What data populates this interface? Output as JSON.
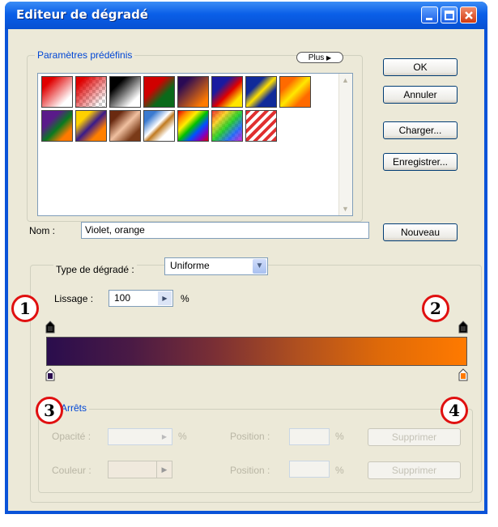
{
  "window": {
    "title": "Editeur de dégradé"
  },
  "presets": {
    "legend": "Paramètres prédéfinis",
    "more_label": "Plus",
    "swatches": [
      {
        "name": "red-white",
        "css": "linear-gradient(135deg,#e00000 20%,#ffffff 80%)"
      },
      {
        "name": "red-transparent",
        "css": "linear-gradient(135deg,#e00000 15%,rgba(255,255,255,0) 85%),repeating-conic-gradient(#ccc 0 25%,#fff 0 50%) 0 0/8px 8px"
      },
      {
        "name": "black-white",
        "css": "linear-gradient(135deg,#000 25%,#ffffff 80%)"
      },
      {
        "name": "red-green",
        "css": "linear-gradient(135deg,#d00000 35%,#0a6a1a 65%)"
      },
      {
        "name": "violet-orange",
        "css": "linear-gradient(135deg,#2a0a55 20%,#ff7a00 85%)"
      },
      {
        "name": "blue-red-yellow",
        "css": "linear-gradient(135deg,#1a1aa0 30%,#e00000 55%,#ffe600 80%)"
      },
      {
        "name": "blue-yellow-blue",
        "css": "linear-gradient(135deg,#102a9a 30%,#ffe000 50%,#102a9a 70%)"
      },
      {
        "name": "orange-yellow-orange",
        "css": "linear-gradient(135deg,#ff6a00 25%,#ffe800 50%,#ff6a00 75%)"
      },
      {
        "name": "violet-green-orange",
        "css": "linear-gradient(135deg,#5a1a8a 30%,#0a7a20 55%,#ff7a00 80%)"
      },
      {
        "name": "yellow-violet-orange",
        "css": "linear-gradient(135deg,#ffd000 25%,#3a1a8a 50%,#ff8000 75%)"
      },
      {
        "name": "copper",
        "css": "linear-gradient(135deg,#6a2a10 20%,#f0c0a0 50%,#7a3a18 80%)"
      },
      {
        "name": "chrome",
        "css": "linear-gradient(135deg,#3a7ad0 20%,#ffffff 45%,#c07a20 55%,#ffffff 75%)"
      },
      {
        "name": "spectrum",
        "css": "linear-gradient(135deg,#e00000,#ff8800,#ffee00,#00c000,#0050ff,#8000c0,#e00000)"
      },
      {
        "name": "transparent-rainbow",
        "css": "linear-gradient(135deg,rgba(230,0,0,0.8),rgba(255,200,0,0.8),rgba(0,200,0,0.8),rgba(0,80,255,0.8),rgba(200,0,200,0.8)),repeating-conic-gradient(#ccc 0 25%,#fff 0 50%) 0 0/8px 8px"
      },
      {
        "name": "transparent-stripes",
        "css": "repeating-linear-gradient(135deg,#e03030 0 4px,#ffffff 4px 8px)"
      }
    ]
  },
  "buttons": {
    "ok": "OK",
    "cancel": "Annuler",
    "load": "Charger...",
    "save": "Enregistrer...",
    "new": "Nouveau"
  },
  "name_field": {
    "label": "Nom :",
    "value": "Violet, orange"
  },
  "gradient_type": {
    "label": "Type de dégradé :",
    "value": "Uniforme"
  },
  "smoothness": {
    "label": "Lissage :",
    "value": "100",
    "unit": "%"
  },
  "gradient_bar": {
    "colors": [
      "#2a0d4d",
      "#4a1a45",
      "#7a2f35",
      "#b0501f",
      "#e06a08",
      "#ff7a00"
    ]
  },
  "stops": {
    "legend": "Arrêts",
    "opacity_label": "Opacité :",
    "opacity_unit": "%",
    "color_label": "Couleur :",
    "position_label": "Position :",
    "position_unit": "%",
    "delete_label": "Supprimer"
  },
  "callouts": [
    "1",
    "2",
    "3",
    "4"
  ]
}
